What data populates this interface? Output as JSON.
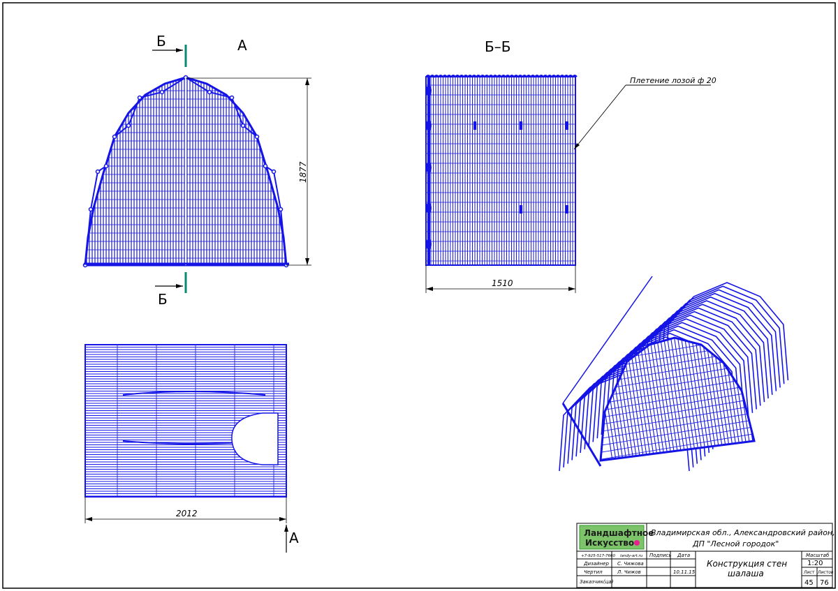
{
  "colors": {
    "drawing": "#1414e6",
    "section_mark": "#0a8a6e",
    "line": "#000000",
    "logo_green": "#2e9e2e",
    "logo_text": "#1a1a1a",
    "logo_dot": "#e6208c",
    "logo_bg": "#7cc36a"
  },
  "view_labels": {
    "front": "А",
    "section": "Б–Б",
    "side_arrow": "А"
  },
  "section_marks": {
    "top": "Б",
    "bottom": "Б"
  },
  "dimensions": {
    "height": "1877",
    "width_section": "1510",
    "width_side": "2012"
  },
  "leader_note": "Плетение лозой ф 20",
  "title_block": {
    "logo_line1": "Ландшафтное",
    "logo_line2": "Искусство",
    "phone": "+7-925-517-7660",
    "site": "landy-art.ru",
    "address_line1": "Владимирская обл., Александровский район,",
    "address_line2": "ДП \"Лесной городок\"",
    "rows": [
      {
        "role": "Дизайнер",
        "name": "С. Чижова",
        "sign": "",
        "date": ""
      },
      {
        "role": "Чертил",
        "name": "Л. Чижов",
        "sign": "",
        "date": "10.11.15"
      },
      {
        "role": "Заказчик(ца)",
        "name": "",
        "sign": "",
        "date": ""
      }
    ],
    "sign_header": "Подпись",
    "date_header": "Дата",
    "title_line1": "Конструкция стен",
    "title_line2": "шалаша",
    "scale_header": "Масштаб",
    "scale": "1:20",
    "sheet_header": "Лист",
    "sheets_header": "Листов",
    "sheet": "45",
    "sheets": "76"
  }
}
